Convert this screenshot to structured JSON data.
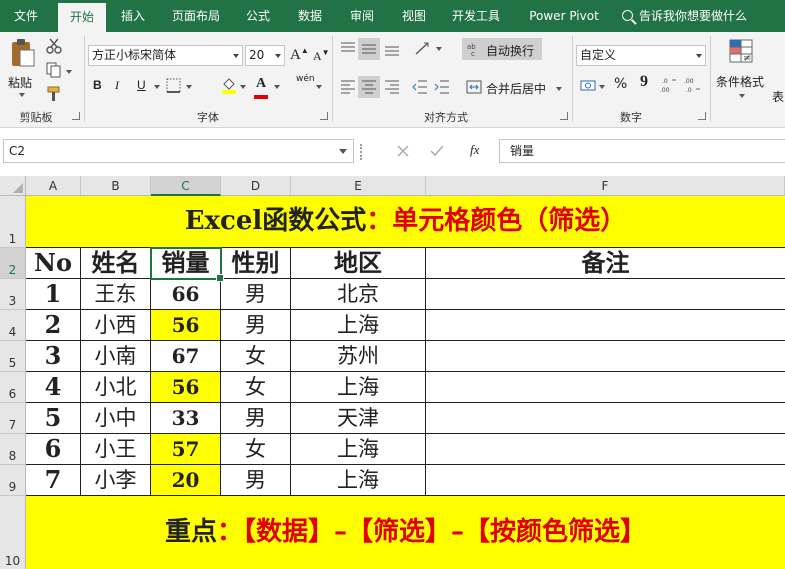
{
  "ribbon_tabs": [
    "文件",
    "开始",
    "插入",
    "页面布局",
    "公式",
    "数据",
    "审阅",
    "视图",
    "开发工具",
    "Power Pivot"
  ],
  "tell_me": "告诉我你想要做什么",
  "clipboard": {
    "paste": "粘贴",
    "group": "剪贴板"
  },
  "font": {
    "name": "方正小标宋简体",
    "size": "20",
    "group": "字体",
    "bold": "B",
    "italic": "I",
    "underline": "U",
    "grow": "A",
    "shrink": "A",
    "phonetic": "wén",
    "font_color_letter": "A"
  },
  "alignment": {
    "wrap": "自动换行",
    "merge": "合并后居中",
    "group": "对齐方式"
  },
  "number": {
    "format": "自定义",
    "percent": "%",
    "comma": "9",
    "group": "数字",
    "inc_decimal": ".00\n→.0",
    "dec_decimal": ".0\n→.00"
  },
  "styles": {
    "conditional": "条件格式",
    "table_partial": "表"
  },
  "formula_bar": {
    "name_box": "C2",
    "fx": "fx",
    "content": "销量"
  },
  "colors": {
    "brand": "#217346",
    "highlight": "#ffff00",
    "accent_red": "#e00000"
  },
  "columns": [
    "A",
    "B",
    "C",
    "D",
    "E",
    "F"
  ],
  "rows": [
    "1",
    "2",
    "3",
    "4",
    "5",
    "6",
    "7",
    "8",
    "9",
    "10"
  ],
  "sheet": {
    "title_black": "Excel函数公式",
    "title_colon": "：",
    "title_red": "单元格颜色（筛选）",
    "headers": [
      "No",
      "姓名",
      "销量",
      "性别",
      "地区",
      "备注"
    ],
    "data": [
      {
        "no": "1",
        "name": "王东",
        "sales": "66",
        "sex": "男",
        "region": "北京",
        "highlight": false
      },
      {
        "no": "2",
        "name": "小西",
        "sales": "56",
        "sex": "男",
        "region": "上海",
        "highlight": true
      },
      {
        "no": "3",
        "name": "小南",
        "sales": "67",
        "sex": "女",
        "region": "苏州",
        "highlight": false
      },
      {
        "no": "4",
        "name": "小北",
        "sales": "56",
        "sex": "女",
        "region": "上海",
        "highlight": true
      },
      {
        "no": "5",
        "name": "小中",
        "sales": "33",
        "sex": "男",
        "region": "天津",
        "highlight": false
      },
      {
        "no": "6",
        "name": "小王",
        "sales": "57",
        "sex": "女",
        "region": "上海",
        "highlight": true
      },
      {
        "no": "7",
        "name": "小李",
        "sales": "20",
        "sex": "男",
        "region": "上海",
        "highlight": true
      }
    ],
    "footer_black": "重点",
    "footer_colon": "：",
    "footer_red": "【数据】–【筛选】–【按颜色筛选】"
  }
}
